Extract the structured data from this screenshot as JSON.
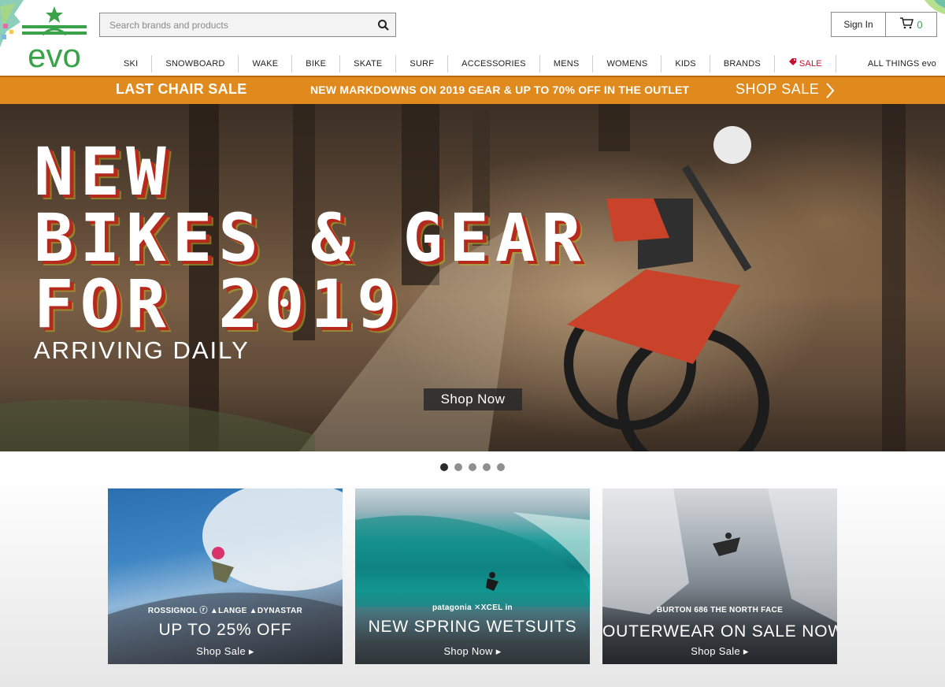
{
  "header": {
    "search_placeholder": "Search brands and products",
    "sign_in": "Sign In",
    "cart_count": "0",
    "logo_text": "evo"
  },
  "nav": {
    "items": [
      "SKI",
      "SNOWBOARD",
      "WAKE",
      "BIKE",
      "SKATE",
      "SURF",
      "ACCESSORIES",
      "MENS",
      "WOMENS",
      "KIDS",
      "BRANDS"
    ],
    "sale": "SALE",
    "all_things": "ALL THINGS evo"
  },
  "promo": {
    "title": "LAST CHAIR SALE",
    "message": "NEW MARKDOWNS ON 2019 GEAR & UP TO 70% OFF IN THE OUTLET",
    "cta": "SHOP SALE"
  },
  "hero": {
    "title_line1": "NEW",
    "title_line2": "BIKES & GEAR",
    "title_line3": "FOR 2019",
    "subtitle": "ARRIVING DAILY",
    "cta": "Shop Now"
  },
  "carousel": {
    "count": 5,
    "active": 0
  },
  "tiles": [
    {
      "brands": "ROSSIGNOL  ⓡ  ▲LANGE  ▲DYNASTAR",
      "headline": "UP TO 25% OFF",
      "cta": "Shop Sale ▸"
    },
    {
      "brands": "patagonia  ✕XCEL  in",
      "headline": "NEW SPRING WETSUITS",
      "cta": "Shop Now ▸"
    },
    {
      "brands": "BURTON  686  THE NORTH FACE",
      "headline": "OUTERWEAR ON SALE NOW",
      "cta": "Shop Sale ▸"
    }
  ],
  "colors": {
    "brand_green": "#3aa34a",
    "promo_orange": "#e08a1e",
    "sale_red": "#c8102e"
  }
}
